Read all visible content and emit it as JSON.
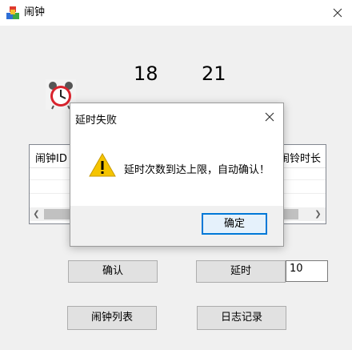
{
  "window": {
    "title": "闹钟"
  },
  "clock": {
    "hour": "18",
    "minute": "21"
  },
  "list": {
    "col_left": "闹钟ID",
    "col_right": "闹铃时长"
  },
  "buttons": {
    "confirm": "确认",
    "delay": "延时",
    "alarm_list": "闹钟列表",
    "log": "日志记录"
  },
  "delay_input": {
    "value": "10"
  },
  "dialog": {
    "title": "延时失败",
    "message": "延时次数到达上限，自动确认！",
    "ok": "确定",
    "icon": "warning-icon"
  },
  "colors": {
    "accent": "#0078d7",
    "warning": "#f5c400",
    "alarm_red": "#d9232d"
  }
}
